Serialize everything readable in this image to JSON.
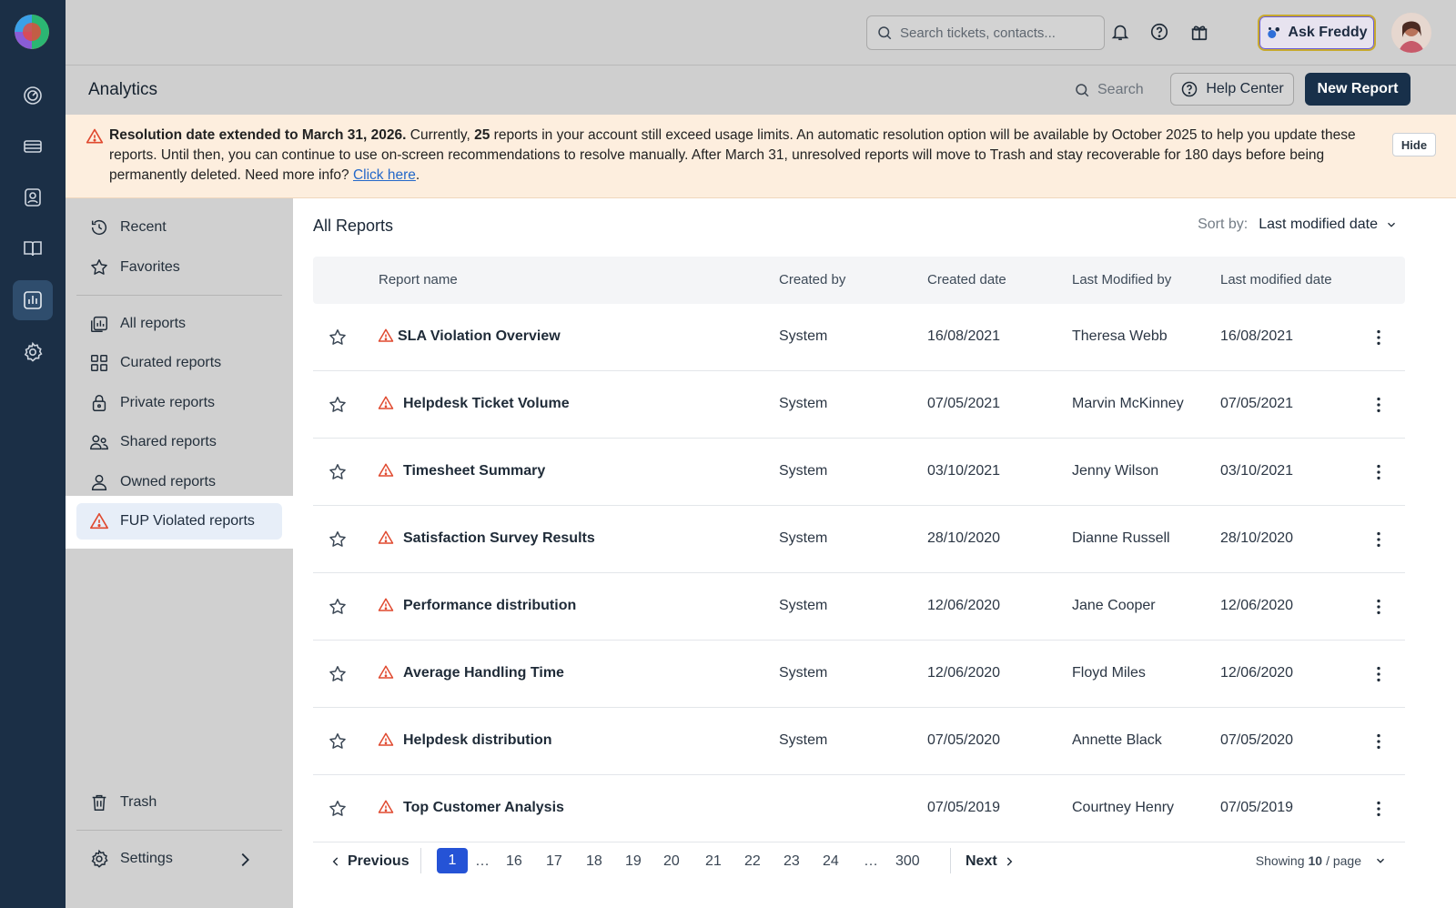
{
  "topbar": {
    "search_placeholder": "Search tickets, contacts...",
    "ask_freddy_label": "Ask Freddy"
  },
  "header": {
    "title": "Analytics",
    "search_label": "Search",
    "help_center_label": "Help Center",
    "new_report_label": "New Report"
  },
  "banner": {
    "bold_text": "Resolution date extended to March 31, 2026.",
    "text_1": " Currently, ",
    "count": "25",
    "text_2": " reports in your account still exceed usage limits. An automatic resolution option will be available by October 2025 to help you update these reports. Until then, you can continue to use on-screen recommendations to resolve manually. After March 31, unresolved reports will move to Trash and stay recoverable for 180 days before being permanently deleted. Need more info? ",
    "link": "Click here",
    "text_3": ".",
    "hide_label": "Hide"
  },
  "sidebar": {
    "items": [
      {
        "label": "Recent",
        "icon": "clock-history-icon"
      },
      {
        "label": "Favorites",
        "icon": "star-icon"
      },
      {
        "label": "All reports",
        "icon": "reports-stack-icon"
      },
      {
        "label": "Curated reports",
        "icon": "grid-icon"
      },
      {
        "label": "Private reports",
        "icon": "lock-icon"
      },
      {
        "label": "Shared reports",
        "icon": "users-icon"
      },
      {
        "label": "Owned reports",
        "icon": "user-icon"
      },
      {
        "label": "FUP Violated reports",
        "icon": "warning-icon",
        "active": true
      }
    ],
    "trash_label": "Trash",
    "settings_label": "Settings"
  },
  "main": {
    "heading": "All Reports",
    "sort_label": "Sort by:",
    "sort_value": "Last modified date",
    "columns": [
      "Report name",
      "Created by",
      "Created date",
      "Last Modified by",
      "Last modified date"
    ],
    "rows": [
      {
        "name": "SLA Violation Overview",
        "created_by": "System",
        "created_date": "16/08/2021",
        "modified_by": "Theresa Webb",
        "modified_date": "16/08/2021"
      },
      {
        "name": "Helpdesk Ticket Volume",
        "created_by": "System",
        "created_date": "07/05/2021",
        "modified_by": "Marvin McKinney",
        "modified_date": "07/05/2021"
      },
      {
        "name": "Timesheet Summary",
        "created_by": "System",
        "created_date": "03/10/2021",
        "modified_by": "Jenny Wilson",
        "modified_date": "03/10/2021"
      },
      {
        "name": "Satisfaction Survey Results",
        "created_by": "System",
        "created_date": "28/10/2020",
        "modified_by": "Dianne Russell",
        "modified_date": "28/10/2020"
      },
      {
        "name": "Performance distribution",
        "created_by": "System",
        "created_date": "12/06/2020",
        "modified_by": "Jane Cooper",
        "modified_date": "12/06/2020"
      },
      {
        "name": "Average Handling Time",
        "created_by": "System",
        "created_date": "12/06/2020",
        "modified_by": "Floyd Miles",
        "modified_date": "12/06/2020"
      },
      {
        "name": "Helpdesk distribution",
        "created_by": "System",
        "created_date": "07/05/2020",
        "modified_by": "Annette Black",
        "modified_date": "07/05/2020"
      },
      {
        "name": "Top Customer Analysis",
        "created_by": "",
        "created_date": "07/05/2019",
        "modified_by": "Courtney Henry",
        "modified_date": "07/05/2019"
      }
    ]
  },
  "pagination": {
    "previous_label": "Previous",
    "next_label": "Next",
    "current": "1",
    "pages": [
      "…",
      "16",
      "17",
      "18",
      "19",
      "20",
      "21",
      "22",
      "23",
      "24",
      "…",
      "300"
    ],
    "showing_prefix": "Showing",
    "showing_count": "10",
    "showing_suffix": "/ page"
  },
  "colors": {
    "rail": "#1b2f46",
    "primary_button": "#18304a",
    "warning": "#e0492f",
    "page_active": "#2553d6",
    "banner_bg": "#fdeede",
    "link": "#2468c9"
  }
}
